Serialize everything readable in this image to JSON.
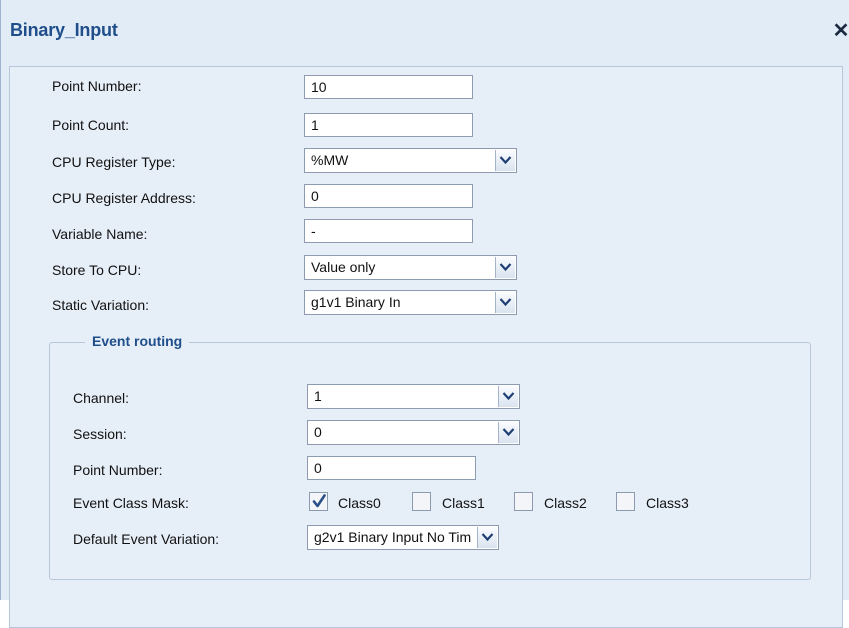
{
  "window": {
    "title": "Binary_Input",
    "close": "✕"
  },
  "fields": {
    "point_number": {
      "label": "Point Number:",
      "value": "10"
    },
    "point_count": {
      "label": "Point Count:",
      "value": "1"
    },
    "cpu_register_type": {
      "label": "CPU Register Type:",
      "value": "%MW"
    },
    "cpu_register_address": {
      "label": "CPU Register Address:",
      "value": "0"
    },
    "variable_name": {
      "label": "Variable Name:",
      "value": "-"
    },
    "store_to_cpu": {
      "label": "Store To CPU:",
      "value": "Value only"
    },
    "static_variation": {
      "label": "Static Variation:",
      "value": "g1v1 Binary In"
    }
  },
  "event_routing": {
    "title": "Event routing",
    "channel": {
      "label": "Channel:",
      "value": "1"
    },
    "session": {
      "label": "Session:",
      "value": "0"
    },
    "point_number": {
      "label": "Point Number:",
      "value": "0"
    },
    "event_class_mask": {
      "label": "Event Class Mask:",
      "classes": [
        {
          "label": "Class0",
          "checked": true
        },
        {
          "label": "Class1",
          "checked": false
        },
        {
          "label": "Class2",
          "checked": false
        },
        {
          "label": "Class3",
          "checked": false
        }
      ]
    },
    "default_event_variation": {
      "label": "Default Event Variation:",
      "value": "g2v1 Binary Input No Tim"
    }
  },
  "icons": {
    "close": "close-icon",
    "dropdown": "chevron-down-icon",
    "check": "checkmark-icon"
  },
  "colors": {
    "title": "#1f4e8a",
    "background": "#e2ecf7",
    "border": "#8c9bb0"
  }
}
